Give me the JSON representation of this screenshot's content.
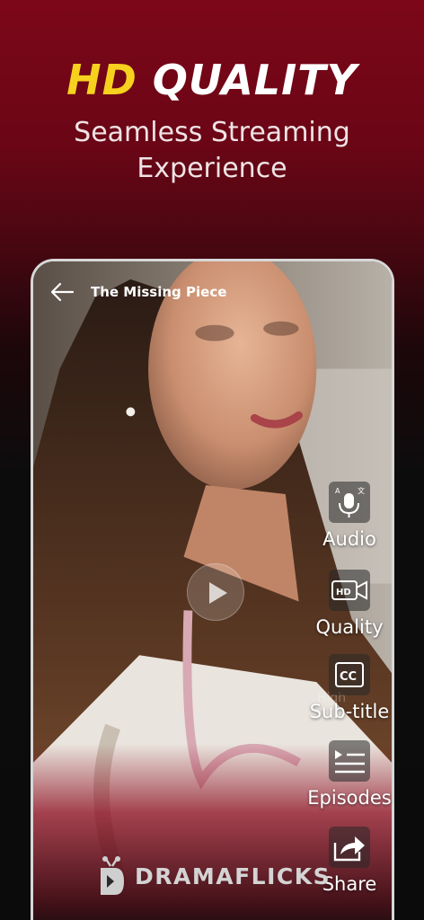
{
  "headline": {
    "hd": "HD",
    "quality": "QUALITY"
  },
  "subheadline": {
    "line1": "Seamless Streaming",
    "line2": "Experience"
  },
  "player": {
    "title": "The Missing Piece",
    "controls": [
      {
        "label": "Audio",
        "icon": "audio-translate-icon"
      },
      {
        "label": "Quality",
        "icon": "hd-camera-icon"
      },
      {
        "label": "Sub-title",
        "icon": "cc-icon"
      },
      {
        "label": "Episodes",
        "icon": "episodes-list-icon"
      },
      {
        "label": "Share",
        "icon": "share-icon"
      }
    ]
  },
  "brand": {
    "name": "DRAMAFLICKS"
  },
  "colors": {
    "accent_yellow": "#f6d21e",
    "brand_red": "#7c0718",
    "background": "#0b0b0b"
  }
}
